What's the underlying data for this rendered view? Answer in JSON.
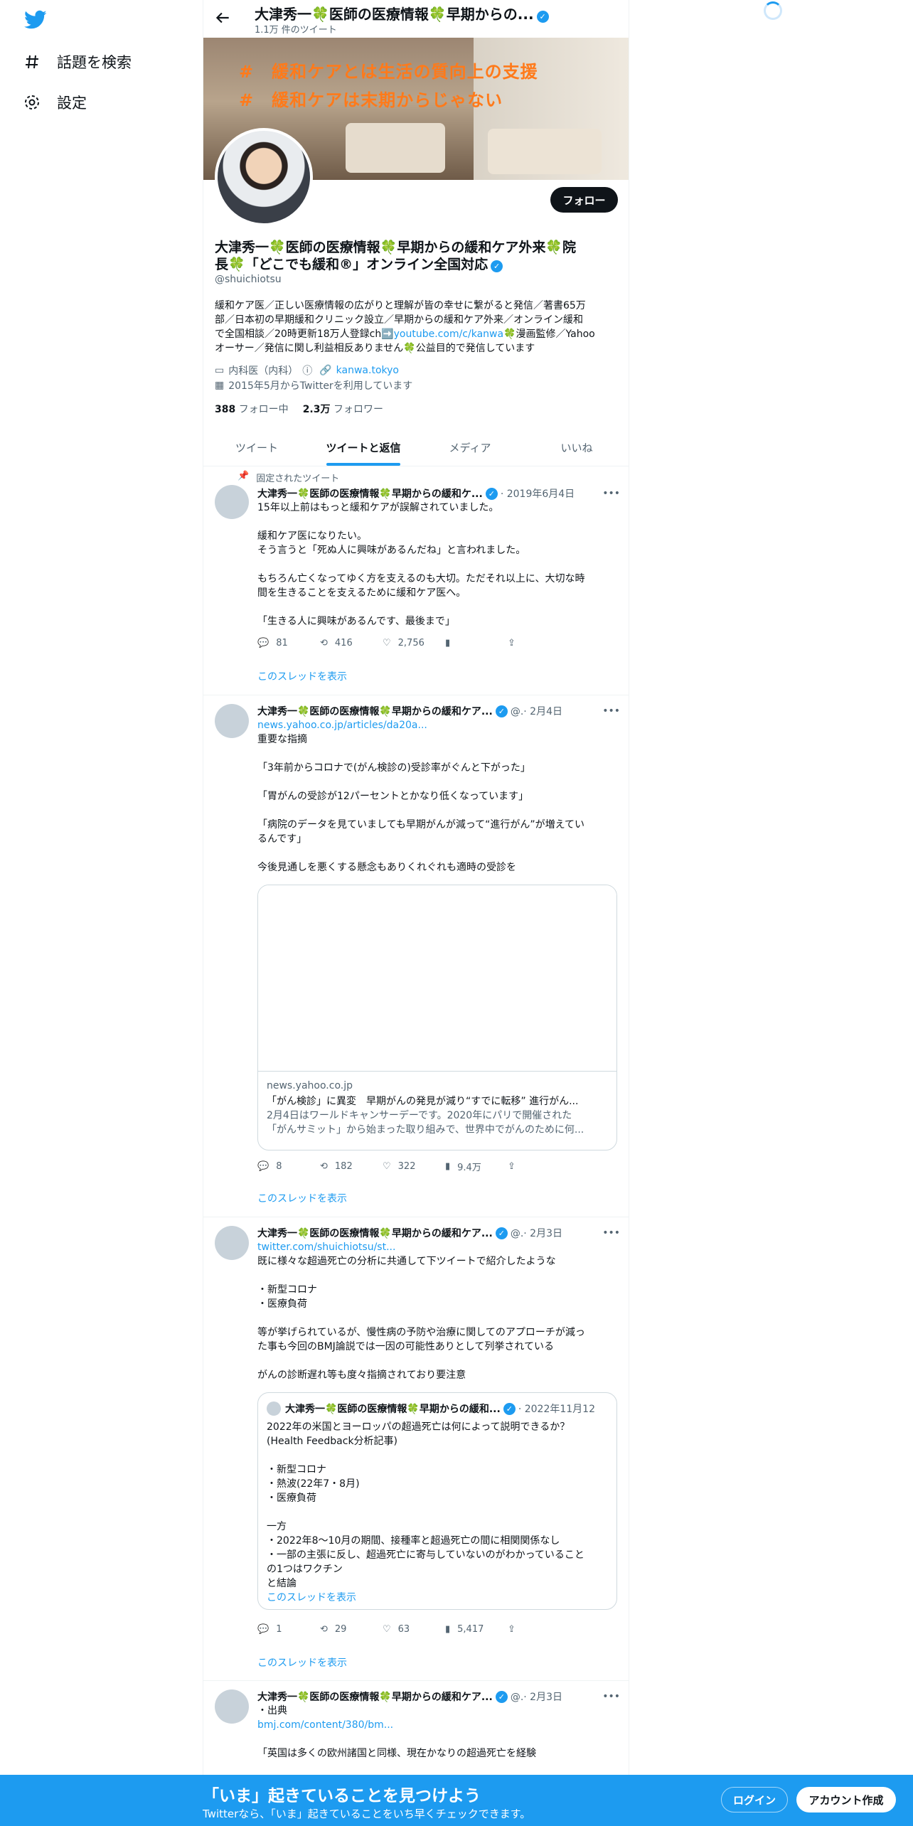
{
  "nav": {
    "items": [
      {
        "label": "話題を検索",
        "icon": "hashtag-icon"
      },
      {
        "label": "設定",
        "icon": "gear-icon"
      }
    ]
  },
  "header": {
    "title": "大津秀一🍀医師の医療情報🍀早期からの...",
    "subtitle": "1.1万 件のツイート"
  },
  "banner": {
    "line1": "#　緩和ケアとは生活の質向上の支援",
    "line2": "#　緩和ケアは末期からじゃない"
  },
  "profile": {
    "follow_label": "フォロー",
    "name_line1": "大津秀一🍀医師の医療情報🍀早期からの緩和ケア外来🍀院",
    "name_line2": "長🍀「どこでも緩和®」オンライン全国対応",
    "handle": "@shuichiotsu",
    "bio": [
      "緩和ケア医／正しい医療情報の広がりと理解が皆の幸せに繋がると発信／著書65万",
      "部／日本初の早期緩和クリニック設立／早期からの緩和ケア外来／オンライン緩和",
      "で全国相談／20時更新18万人登録ch➡️",
      "オーサー／発信に関し利益相反ありません🍀公益目的で発信しています"
    ],
    "bio_link": "youtube.com/c/kanwa",
    "bio_after_link": "🍀漫画監修／Yahoo",
    "category": "内科医（内科）",
    "website": "kanwa.tokyo",
    "joined": "2015年5月からTwitterを利用しています",
    "following_count": "388",
    "following_label": "フォロー中",
    "followers_count": "2.3万",
    "followers_label": "フォロワー"
  },
  "tabs": [
    "ツイート",
    "ツイートと返信",
    "メディア",
    "いいね"
  ],
  "tweets": [
    {
      "pinned_label": "固定されたツイート",
      "name": "大津秀一🍀医師の医療情報🍀早期からの緩和ケ...",
      "date": "· 2019年6月4日",
      "lines": [
        "15年以上前はもっと緩和ケアが誤解されていました。",
        "緩和ケア医になりたい。",
        "そう言うと「死ぬ人に興味があるんだね」と言われました。",
        "もちろん亡くなってゆく方を支えるのも大切。ただそれ以上に、大切な時",
        "間を生きることを支えるために緩和ケア医へ。",
        "「生きる人に興味があるんです、最後まで」"
      ],
      "replies": "81",
      "retweets": "416",
      "likes": "2,756",
      "thread": "このスレッドを表示"
    },
    {
      "name": "大津秀一🍀医師の医療情報🍀早期からの緩和ケア...",
      "date": "@.· 2月4日",
      "link": "news.yahoo.co.jp/articles/da20a...",
      "lines": [
        "重要な指摘",
        "「3年前からコロナで(がん検診の)受診率がぐんと下がった」",
        "「胃がんの受診が12パーセントとかなり低くなっています」",
        "「病院のデータを見ていましても早期がんが減って“進行がん”が増えてい",
        "るんです」",
        "今後見通しを悪くする懸念もありくれぐれも適時の受診を"
      ],
      "card_domain": "news.yahoo.co.jp",
      "card_title": "「がん検診」に異変　早期がんの発見が減り“すでに転移” 進行がん...",
      "card_desc1": "2月4日はワールドキャンサーデーです。2020年にパリで開催された",
      "card_desc2": "「がんサミット」から始まった取り組みで、世界中でがんのために何...",
      "replies": "8",
      "retweets": "182",
      "likes": "322",
      "views": "9.4万",
      "thread": "このスレッドを表示"
    },
    {
      "name": "大津秀一🍀医師の医療情報🍀早期からの緩和ケア...",
      "date": "@.· 2月3日",
      "link": "twitter.com/shuichiotsu/st...",
      "lines": [
        "既に様々な超過死亡の分析に共通して下ツイートで紹介したような",
        "・新型コロナ",
        "・医療負荷",
        "等が挙げられているが、慢性病の予防や治療に関してのアプローチが減っ",
        "た事も今回のBMJ論説では一因の可能性ありとして列挙されている",
        "がんの診断遅れ等も度々指摘されており要注意"
      ],
      "quote": {
        "name": "大津秀一🍀医師の医療情報🍀早期からの緩和...",
        "date": "· 2022年11月12",
        "lines": [
          "2022年の米国とヨーロッパの超過死亡は何によって説明できるか？",
          "(Health Feedback分析記事)",
          "・新型コロナ",
          "・熱波(22年7・8月)",
          "・医療負荷",
          "一方",
          "・2022年8～10月の期間、接種率と超過死亡の間に相関関係なし",
          "・一部の主張に反し、超過死亡に寄与していないのがわかっていること",
          "の1つはワクチン",
          "と結論"
        ],
        "thread": "このスレッドを表示"
      },
      "replies": "1",
      "retweets": "29",
      "likes": "63",
      "views": "5,417",
      "thread": "このスレッドを表示"
    },
    {
      "name": "大津秀一🍀医師の医療情報🍀早期からの緩和ケア...",
      "date": "@.· 2月3日",
      "lines": [
        "・出典",
        "「英国は多くの欧州諸国と同様、現在かなりの超過死亡を経験"
      ],
      "link": "bmj.com/content/380/bm..."
    }
  ],
  "bottom_bar": {
    "headline": "「いま」起きていることを見つけよう",
    "subline": "Twitterなら、「いま」起きていることをいち早くチェックできます。",
    "login_label": "ログイン",
    "signup_label": "アカウント作成"
  },
  "colors": {
    "accent": "#1d9bf0",
    "text": "#0f1419",
    "muted": "#536471",
    "banner_text": "#ff7a1a"
  }
}
